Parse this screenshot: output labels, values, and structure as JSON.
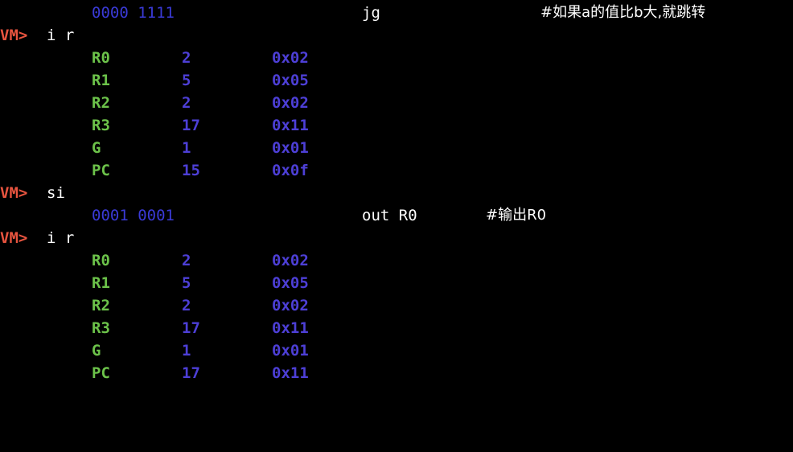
{
  "prompt": "VM>",
  "lines": [
    {
      "kind": "instr",
      "bin": "0000 1111",
      "op": "jg",
      "comment": "#如果a的值比b大,就跳转"
    },
    {
      "kind": "cmd",
      "text": "i r"
    },
    {
      "kind": "reg",
      "name": "R0",
      "dec": "2",
      "hex": "0x02"
    },
    {
      "kind": "reg",
      "name": "R1",
      "dec": "5",
      "hex": "0x05"
    },
    {
      "kind": "reg",
      "name": "R2",
      "dec": "2",
      "hex": "0x02"
    },
    {
      "kind": "reg",
      "name": "R3",
      "dec": "17",
      "hex": "0x11"
    },
    {
      "kind": "reg",
      "name": "G",
      "dec": "1",
      "hex": "0x01"
    },
    {
      "kind": "reg",
      "name": "PC",
      "dec": "15",
      "hex": "0x0f"
    },
    {
      "kind": "cmd",
      "text": "si"
    },
    {
      "kind": "instr",
      "bin": "0001 0001",
      "op": "out R0",
      "comment": "#输出R0"
    },
    {
      "kind": "cmd",
      "text": "i r"
    },
    {
      "kind": "reg",
      "name": "R0",
      "dec": "2",
      "hex": "0x02"
    },
    {
      "kind": "reg",
      "name": "R1",
      "dec": "5",
      "hex": "0x05"
    },
    {
      "kind": "reg",
      "name": "R2",
      "dec": "2",
      "hex": "0x02"
    },
    {
      "kind": "reg",
      "name": "R3",
      "dec": "17",
      "hex": "0x11"
    },
    {
      "kind": "reg",
      "name": "G",
      "dec": "1",
      "hex": "0x01"
    },
    {
      "kind": "reg",
      "name": "PC",
      "dec": "17",
      "hex": "0x11"
    }
  ],
  "colors": {
    "background": "#000000",
    "prompt": "#e8543f",
    "register_name": "#6cc24a",
    "register_value": "#4d3fd6",
    "binary": "#3a3ad6",
    "text": "#ffffff"
  }
}
